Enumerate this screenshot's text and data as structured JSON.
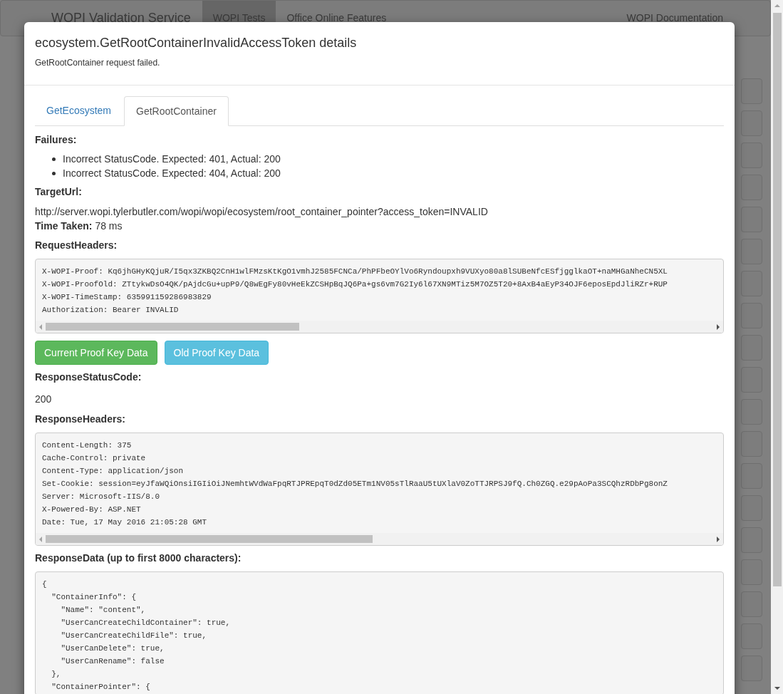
{
  "background_page": {
    "brand": "WOPI Validation Service",
    "nav": [
      {
        "label": "WOPI Tests",
        "selected": true
      },
      {
        "label": "Office Online Features",
        "selected": false
      }
    ],
    "nav_right": "WOPI Documentation"
  },
  "modal": {
    "title": "ecosystem.GetRootContainerInvalidAccessToken details",
    "subtitle": "GetRootContainer request failed.",
    "tabs": [
      {
        "label": "GetEcosystem",
        "selected": false
      },
      {
        "label": "GetRootContainer",
        "selected": true
      }
    ],
    "failures": {
      "heading": "Failures:",
      "items": [
        "Incorrect StatusCode. Expected: 401, Actual: 200",
        "Incorrect StatusCode. Expected: 404, Actual: 200"
      ]
    },
    "target_url": {
      "heading": "TargetUrl:",
      "value": "http://server.wopi.tylerbutler.com/wopi/wopi/ecosystem/root_container_pointer?access_token=INVALID"
    },
    "time_taken": {
      "label": "Time Taken:",
      "value": "78 ms"
    },
    "request_headers": {
      "heading": "RequestHeaders:",
      "lines": [
        "X-WOPI-Proof: Kq6jhGHyKQjuR/I5qx3ZKBQ2CnH1wlFMzsKtKgO1vmhJ2585FCNCa/PhPFbeOYlVo6Ryndoupxh9VUXyo80a8lSUBeNfcESfjgglkaOT+naMHGaNheCN5XL",
        "X-WOPI-ProofOld: ZTtykwDsO4QK/pAjdcGu+upP9/Q8wEgFy80vHeEkZCSHpBqJQ6Pa+gs6vm7G2Iy6l67XN9MTiz5M7OZ5T20+8AxB4aEyP34OJF6eposEpdJliRZr+RUP",
        "X-WOPI-TimeStamp: 635991159286983829",
        "Authorization: Bearer INVALID"
      ]
    },
    "buttons": [
      {
        "label": "Current Proof Key Data",
        "kind": "success"
      },
      {
        "label": "Old Proof Key Data",
        "kind": "info"
      }
    ],
    "response_status": {
      "heading": "ResponseStatusCode:",
      "value": "200"
    },
    "response_headers": {
      "heading": "ResponseHeaders:",
      "lines": [
        "Content-Length: 375",
        "Cache-Control: private",
        "Content-Type: application/json",
        "Set-Cookie: session=eyJfaWQiOnsiIGIiOiJNemhtWVdWaFpqRTJPREpqT0dZd05ETm1NV05sTlRaaU5tUXlaV0ZoTTJRPSJ9fQ.Ch0ZGQ.e29pAoPa3SCQhzRDbPg8onZ",
        "Server: Microsoft-IIS/8.0",
        "X-Powered-By: ASP.NET",
        "Date: Tue, 17 May 2016 21:05:28 GMT"
      ]
    },
    "response_data": {
      "heading": "ResponseData (up to first 8000 characters):",
      "lines": [
        "{",
        "  \"ContainerInfo\": {",
        "    \"Name\": \"content\",",
        "    \"UserCanCreateChildContainer\": true,",
        "    \"UserCanCreateChildFile\": true,",
        "    \"UserCanDelete\": true,",
        "    \"UserCanRename\": false",
        "  },",
        "  \"ContainerPointer\": {"
      ]
    }
  }
}
